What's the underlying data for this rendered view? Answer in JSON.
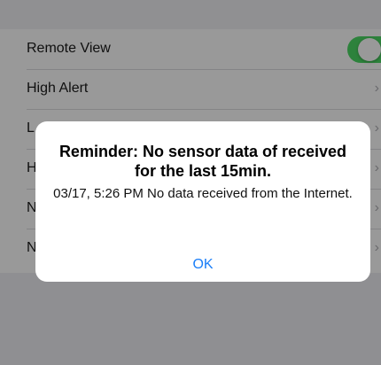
{
  "settings": {
    "rows": [
      {
        "label": "Remote View",
        "control": "toggle",
        "toggle_on": true
      },
      {
        "label": "High Alert",
        "control": "chevron"
      },
      {
        "label": "L",
        "control": "chevron"
      },
      {
        "label": "H",
        "control": "chevron"
      },
      {
        "label": "N",
        "control": "chevron"
      },
      {
        "label": "N",
        "control": "chevron"
      }
    ],
    "chevron_glyph": "›"
  },
  "alert": {
    "title": "Reminder: No sensor data of received for the last 15min.",
    "message": "03/17, 5:26 PM No data received from the Internet.",
    "ok_label": "OK"
  },
  "colors": {
    "toggle_on": "#4cd964",
    "link_blue": "#1a7ef8",
    "overlay": "rgba(0,0,0,0.40)"
  }
}
